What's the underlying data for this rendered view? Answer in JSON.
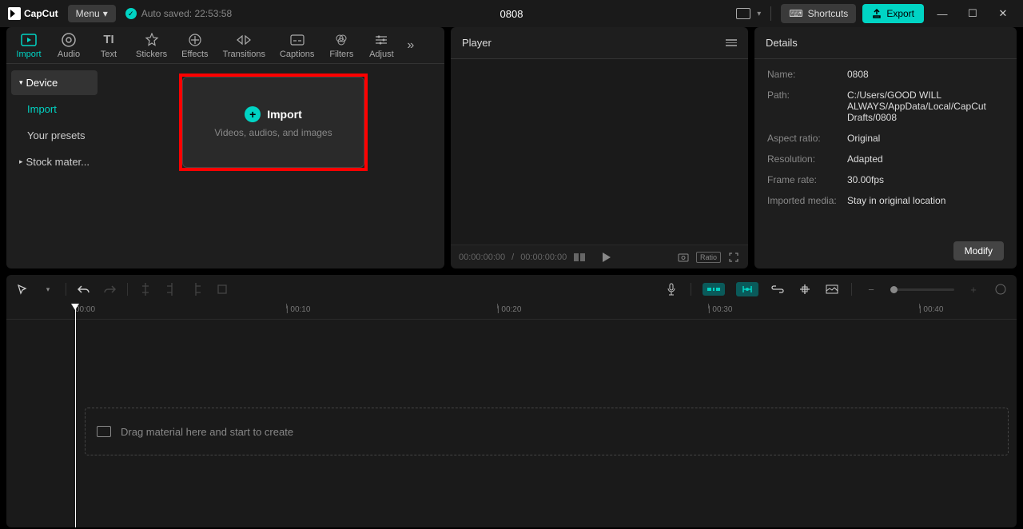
{
  "app": {
    "name": "CapCut",
    "menu_label": "Menu",
    "autosave": "Auto saved: 22:53:58",
    "project_title": "0808"
  },
  "titlebar": {
    "shortcuts": "Shortcuts",
    "export": "Export"
  },
  "tabs": [
    "Import",
    "Audio",
    "Text",
    "Stickers",
    "Effects",
    "Transitions",
    "Captions",
    "Filters",
    "Adjust"
  ],
  "sidebar": {
    "device": "Device",
    "import": "Import",
    "presets": "Your presets",
    "stock": "Stock mater..."
  },
  "import_box": {
    "title": "Import",
    "subtitle": "Videos, audios, and images"
  },
  "player": {
    "header": "Player",
    "time_current": "00:00:00:00",
    "time_total": "00:00:00:00",
    "ratio": "Ratio"
  },
  "details": {
    "header": "Details",
    "rows": {
      "name_label": "Name:",
      "name_value": "0808",
      "path_label": "Path:",
      "path_value": "C:/Users/GOOD WILL ALWAYS/AppData/Local/CapCut Drafts/0808",
      "aspect_label": "Aspect ratio:",
      "aspect_value": "Original",
      "res_label": "Resolution:",
      "res_value": "Adapted",
      "fps_label": "Frame rate:",
      "fps_value": "30.00fps",
      "media_label": "Imported media:",
      "media_value": "Stay in original location"
    },
    "modify": "Modify"
  },
  "timeline": {
    "marks": [
      "00:00",
      "| 00:10",
      "| 00:20",
      "| 00:30",
      "| 00:40"
    ],
    "drag_hint": "Drag material here and start to create"
  }
}
